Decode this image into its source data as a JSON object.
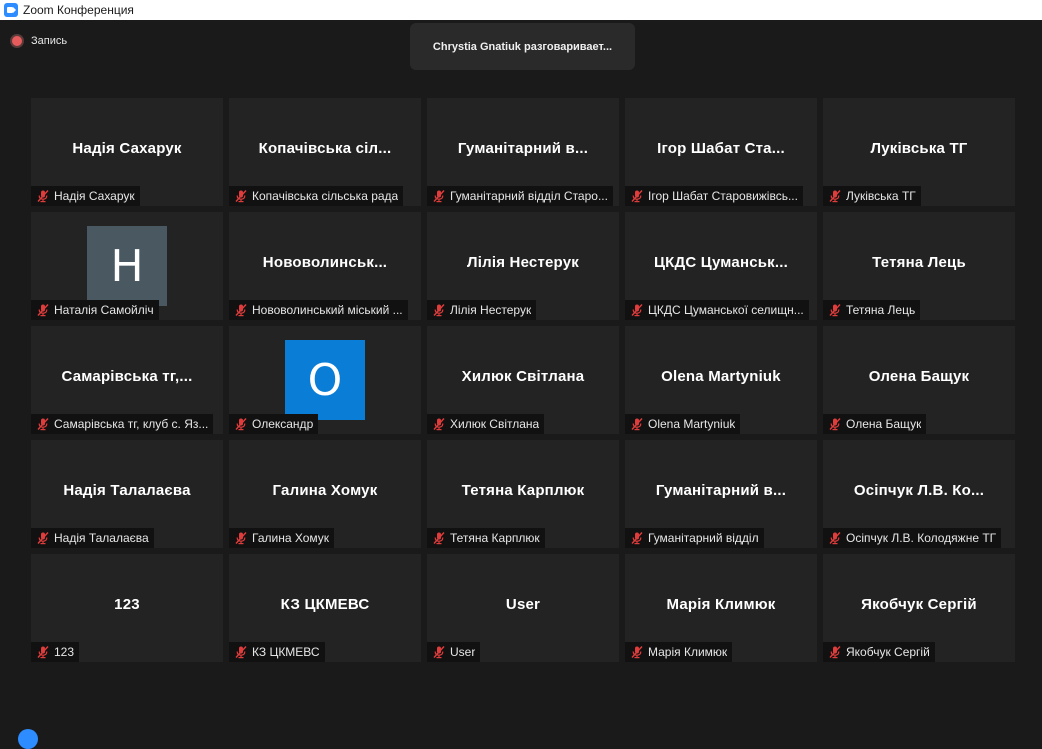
{
  "window": {
    "title": "Zoom Конференция"
  },
  "recording": {
    "label": "Запись"
  },
  "speaker": {
    "text": "Chrystia Gnatiuk разговаривает..."
  },
  "colors": {
    "accent": "#2d8cff",
    "muted": "#e03c3c",
    "tile_bg": "#232323"
  },
  "participants": [
    {
      "display": "Надія Сахарук",
      "label": "Надія Сахарук",
      "muted": true
    },
    {
      "display": "Копачівська сіл...",
      "label": "Копачівська сільська рада",
      "muted": true
    },
    {
      "display": "Гуманітарний в...",
      "label": "Гуманітарний відділ Старо...",
      "muted": true
    },
    {
      "display": "Ігор Шабат Ста...",
      "label": "Ігор Шабат Старовижівсь...",
      "muted": true
    },
    {
      "display": "Луківська ТГ",
      "label": "Луківська ТГ",
      "muted": true
    },
    {
      "display": "",
      "avatar": "H",
      "avatar_color": "#4a5862",
      "label": "Наталія Самойліч",
      "muted": true
    },
    {
      "display": "Нововолинськ...",
      "label": "Нововолинський міський ...",
      "muted": true
    },
    {
      "display": "Лілія Нестерук",
      "label": "Лілія Нестерук",
      "muted": true
    },
    {
      "display": "ЦКДС Цуманськ...",
      "label": "ЦКДС Цуманської селищн...",
      "muted": true
    },
    {
      "display": "Тетяна Лець",
      "label": "Тетяна Лець",
      "muted": true
    },
    {
      "display": "Самарівська тг,...",
      "label": "Самарівська тг, клуб с. Яз...",
      "muted": true
    },
    {
      "display": "",
      "avatar": "O",
      "avatar_color": "#0a7ed6",
      "label": "Олександр",
      "muted": true
    },
    {
      "display": "Хилюк Світлана",
      "label": "Хилюк Світлана",
      "muted": true
    },
    {
      "display": "Olena Martyniuk",
      "label": "Olena Martyniuk",
      "muted": true
    },
    {
      "display": "Олена Бащук",
      "label": "Олена Бащук",
      "muted": true
    },
    {
      "display": "Надія Талалаєва",
      "label": "Надія Талалаєва",
      "muted": true
    },
    {
      "display": "Галина Хомук",
      "label": "Галина Хомук",
      "muted": true
    },
    {
      "display": "Тетяна Карплюк",
      "label": "Тетяна Карплюк",
      "muted": true
    },
    {
      "display": "Гуманітарний в...",
      "label": "Гуманітарний відділ",
      "muted": true
    },
    {
      "display": "Осіпчук Л.В. Ко...",
      "label": "Осіпчук Л.В. Колодяжне ТГ",
      "muted": true
    },
    {
      "display": "123",
      "label": "123",
      "muted": true
    },
    {
      "display": "КЗ ЦКМЕВС",
      "label": "КЗ ЦКМЕВС",
      "muted": true
    },
    {
      "display": "User",
      "label": "User",
      "muted": true
    },
    {
      "display": "Марія Климюк",
      "label": "Марія Климюк",
      "muted": true
    },
    {
      "display": "Якобчук Сергій",
      "label": "Якобчук Сергій",
      "muted": true
    }
  ]
}
